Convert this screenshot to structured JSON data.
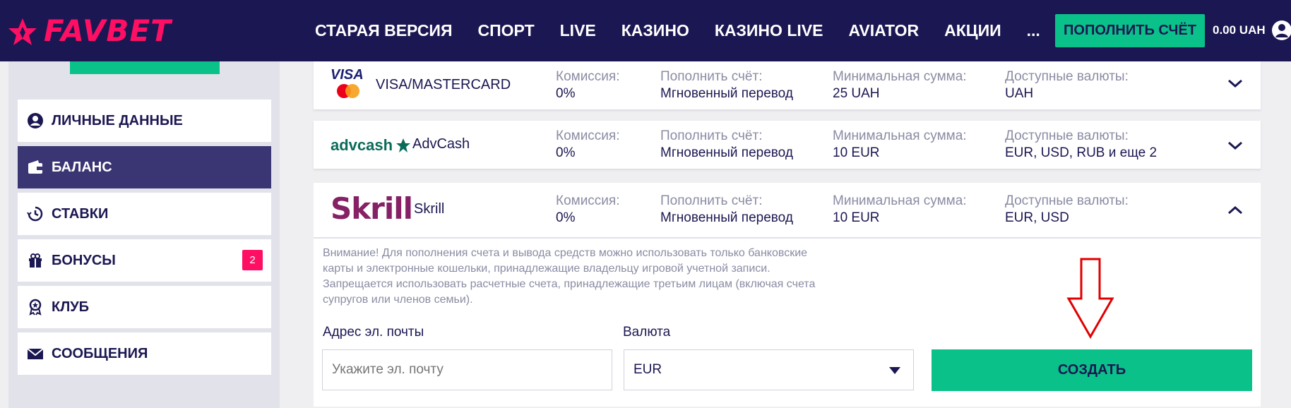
{
  "header": {
    "logo_text": "FAVBET",
    "nav": [
      "СТАРАЯ ВЕРСИЯ",
      "СПОРТ",
      "LIVE",
      "КАЗИНО",
      "КАЗИНО LIVE",
      "AVIATOR",
      "АКЦИИ",
      "..."
    ],
    "deposit_button": "ПОПОЛНИТЬ СЧЁТ",
    "balance": "0.00 UAH",
    "user_icon": "user-icon"
  },
  "sidebar": {
    "items": [
      {
        "label": "ЛИЧНЫЕ ДАННЫЕ",
        "icon": "user-circle-icon"
      },
      {
        "label": "БАЛАНС",
        "icon": "wallet-icon",
        "active": true
      },
      {
        "label": "СТАВКИ",
        "icon": "history-icon"
      },
      {
        "label": "БОНУСЫ",
        "icon": "gift-icon",
        "badge": "2"
      },
      {
        "label": "КЛУБ",
        "icon": "award-icon"
      },
      {
        "label": "СООБЩЕНИЯ",
        "icon": "envelope-icon"
      }
    ]
  },
  "labels": {
    "commission": "Комиссия:",
    "deposit": "Пополнить счёт:",
    "min_amount": "Минимальная сумма:",
    "currencies": "Доступные валюты:"
  },
  "methods": [
    {
      "logo": "VISA",
      "name": "VISA/MASTERCARD",
      "commission": "0%",
      "deposit": "Мгновенный перевод",
      "min_amount": "25 UAH",
      "currencies": "UAH"
    },
    {
      "logo": "advcash",
      "name": "AdvCash",
      "commission": "0%",
      "deposit": "Мгновенный перевод",
      "min_amount": "10 EUR",
      "currencies": "EUR, USD, RUB и еще 2"
    },
    {
      "logo": "Skrill",
      "name": "Skrill",
      "commission": "0%",
      "deposit": "Мгновенный перевод",
      "min_amount": "10 EUR",
      "currencies": "EUR, USD"
    }
  ],
  "form": {
    "notice": "Внимание! Для пополнения счета и вывода средств можно использовать только банковские карты и электронные кошельки, принадлежащие владельцу игровой учетной записи. Запрещается использовать расчетные счета, принадлежащие третьим лицам (включая счета супругов или членов семьи).",
    "email_label": "Адрес эл. почты",
    "email_placeholder": "Укажите эл. почту",
    "currency_label": "Валюта",
    "currency_value": "EUR",
    "create_button": "СОЗДАТЬ"
  },
  "colors": {
    "brand": "#ff0f64",
    "header_bg": "#1b1752",
    "accent": "#0bc18a",
    "annotation": "#e00000"
  }
}
